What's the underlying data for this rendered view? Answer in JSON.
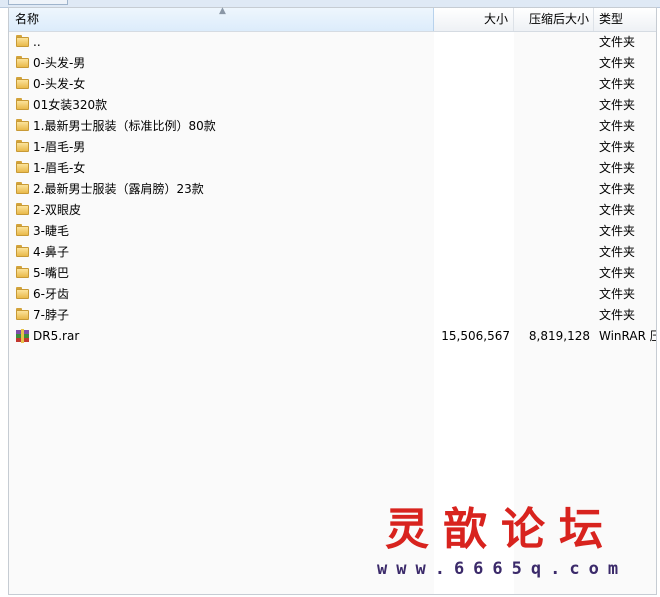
{
  "columns": {
    "name": "名称",
    "size": "大小",
    "packed": "压缩后大小",
    "type": "类型"
  },
  "rows": [
    {
      "name": "..",
      "size": "",
      "packed": "",
      "type": "文件夹",
      "icon": "folder-icon"
    },
    {
      "name": "0-头发-男",
      "size": "",
      "packed": "",
      "type": "文件夹",
      "icon": "folder-icon"
    },
    {
      "name": "0-头发-女",
      "size": "",
      "packed": "",
      "type": "文件夹",
      "icon": "folder-icon"
    },
    {
      "name": "01女装320款",
      "size": "",
      "packed": "",
      "type": "文件夹",
      "icon": "folder-icon"
    },
    {
      "name": "1.最新男士服装（标准比例）80款",
      "size": "",
      "packed": "",
      "type": "文件夹",
      "icon": "folder-icon"
    },
    {
      "name": "1-眉毛-男",
      "size": "",
      "packed": "",
      "type": "文件夹",
      "icon": "folder-icon"
    },
    {
      "name": "1-眉毛-女",
      "size": "",
      "packed": "",
      "type": "文件夹",
      "icon": "folder-icon"
    },
    {
      "name": "2.最新男士服装（露肩膀）23款",
      "size": "",
      "packed": "",
      "type": "文件夹",
      "icon": "folder-icon"
    },
    {
      "name": "2-双眼皮",
      "size": "",
      "packed": "",
      "type": "文件夹",
      "icon": "folder-icon"
    },
    {
      "name": "3-睫毛",
      "size": "",
      "packed": "",
      "type": "文件夹",
      "icon": "folder-icon"
    },
    {
      "name": "4-鼻子",
      "size": "",
      "packed": "",
      "type": "文件夹",
      "icon": "folder-icon"
    },
    {
      "name": "5-嘴巴",
      "size": "",
      "packed": "",
      "type": "文件夹",
      "icon": "folder-icon"
    },
    {
      "name": "6-牙齿",
      "size": "",
      "packed": "",
      "type": "文件夹",
      "icon": "folder-icon"
    },
    {
      "name": "7-脖子",
      "size": "",
      "packed": "",
      "type": "文件夹",
      "icon": "folder-icon"
    },
    {
      "name": "DR5.rar",
      "size": "15,506,567",
      "packed": "8,819,128",
      "type": "WinRAR 压",
      "icon": "rar-archive-icon"
    }
  ],
  "watermark": {
    "title": "灵歆论坛",
    "url": "www.6665q.com",
    "title_color": "#d8231e",
    "url_color": "#3b2a6a"
  }
}
